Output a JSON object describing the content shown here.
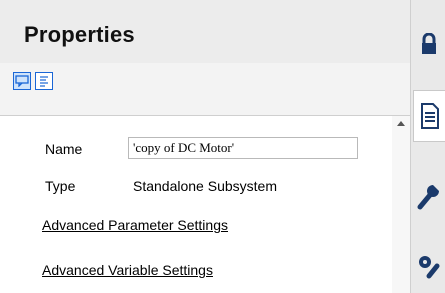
{
  "panel": {
    "title": "Properties"
  },
  "toolbar": {
    "buttons": [
      {
        "icon": "comment-view-icon",
        "active": true
      },
      {
        "icon": "list-view-icon",
        "active": false
      }
    ]
  },
  "properties": {
    "name_label": "Name",
    "name_value": "'copy of DC Motor'",
    "type_label": "Type",
    "type_value": "Standalone Subsystem"
  },
  "links": {
    "advanced_parameters": "Advanced Parameter Settings",
    "advanced_variables": "Advanced Variable Settings"
  },
  "right_tabs": [
    {
      "icon": "lock-icon"
    },
    {
      "icon": "document-icon",
      "active": true
    },
    {
      "icon": "wrench-icon"
    },
    {
      "icon": "gear-wrench-icon"
    }
  ],
  "colors": {
    "accent": "#1a66d6",
    "header_bg": "#ececec",
    "toolbar_bg": "#f3f3f3",
    "strip_bg": "#e9e9e9"
  }
}
